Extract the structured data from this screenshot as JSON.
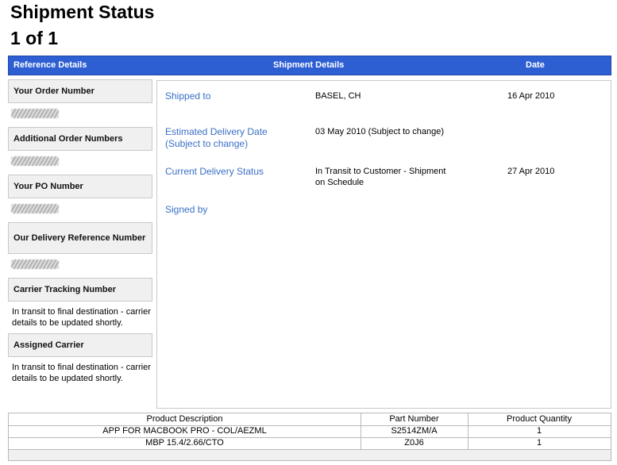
{
  "page": {
    "title": "Shipment Status",
    "pagination": "1 of 1"
  },
  "header": {
    "reference_details": "Reference Details",
    "shipment_details": "Shipment Details",
    "date": "Date"
  },
  "references": [
    {
      "label": "Your Order Number",
      "value": null
    },
    {
      "label": "Additional Order Numbers",
      "value": null
    },
    {
      "label": "Your PO Number",
      "value": null
    },
    {
      "label": "Our Delivery Reference Number",
      "value": null
    },
    {
      "label": "Carrier Tracking Number",
      "value": "In transit to final destination - carrier details to be updated shortly."
    },
    {
      "label": "Assigned Carrier",
      "value": "In transit to final destination - carrier details to be updated shortly."
    }
  ],
  "shipment": [
    {
      "label": "Shipped to",
      "value": "BASEL, CH",
      "date": "16 Apr 2010"
    },
    {
      "label": "Estimated Delivery Date (Subject to change)",
      "value": "03 May 2010 (Subject to change)",
      "date": ""
    },
    {
      "label": "Current Delivery Status",
      "value": "In Transit to Customer - Shipment on Schedule",
      "date": "27 Apr 2010"
    },
    {
      "label": "Signed by",
      "value": "",
      "date": ""
    }
  ],
  "products": {
    "headers": [
      "Product Description",
      "Part Number",
      "Product Quantity"
    ],
    "rows": [
      [
        "APP FOR MACBOOK PRO - COL/AEZML",
        "S2514ZM/A",
        "1"
      ],
      [
        "MBP 15.4/2.66/CTO",
        "Z0J6",
        "1"
      ]
    ]
  },
  "colors": {
    "header_bar": "#2d5fd3",
    "label_blue": "#3a6fc7",
    "label_bg": "#f0f0f0"
  }
}
